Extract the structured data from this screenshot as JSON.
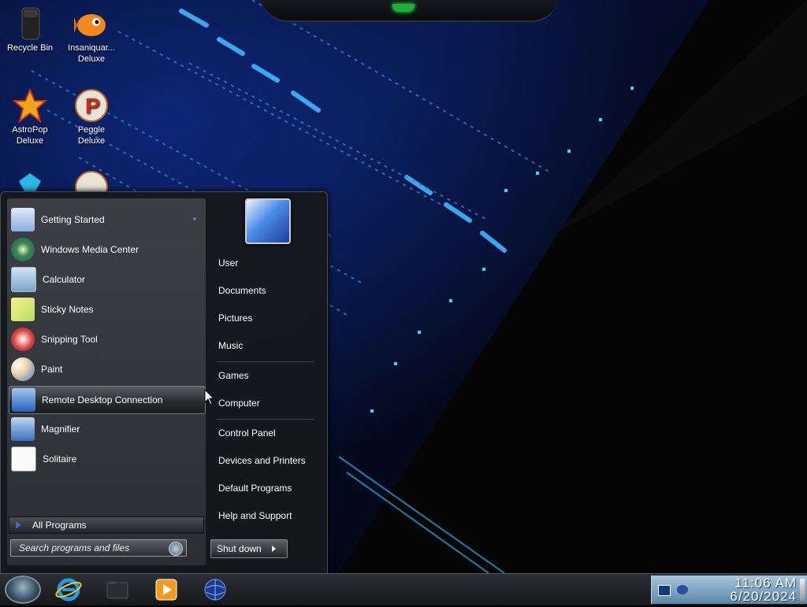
{
  "desktop": {
    "icons": [
      {
        "label_line1": "Recycle Bin",
        "label_line2": ""
      },
      {
        "label_line1": "Insaniquar...",
        "label_line2": "Deluxe"
      },
      {
        "label_line1": "AstroPop",
        "label_line2": "Deluxe"
      },
      {
        "label_line1": "Peggle",
        "label_line2": "Deluxe"
      }
    ]
  },
  "start_menu": {
    "programs": [
      {
        "label": "Getting Started",
        "icon": "getting-started-icon"
      },
      {
        "label": "Windows Media Center",
        "icon": "media-center-icon"
      },
      {
        "label": "Calculator",
        "icon": "calculator-icon"
      },
      {
        "label": "Sticky Notes",
        "icon": "sticky-notes-icon"
      },
      {
        "label": "Snipping Tool",
        "icon": "snipping-tool-icon"
      },
      {
        "label": "Paint",
        "icon": "paint-icon"
      },
      {
        "label": "Remote Desktop Connection",
        "icon": "remote-desktop-icon"
      },
      {
        "label": "Magnifier",
        "icon": "magnifier-icon"
      },
      {
        "label": "Solitaire",
        "icon": "solitaire-icon"
      }
    ],
    "all_programs": "All Programs",
    "search_placeholder": "Search programs and files",
    "right_items": [
      "User",
      "Documents",
      "Pictures",
      "Music",
      "Games",
      "Computer",
      "Control Panel",
      "Devices and Printers",
      "Default Programs",
      "Help and Support"
    ],
    "shutdown_label": "Shut down"
  },
  "taskbar": {
    "clock_time": "11:06 AM",
    "clock_date": "6/20/2024"
  },
  "colors": {
    "accent": "#4163d8",
    "wallpaper_glow": "#2fd7ff"
  }
}
